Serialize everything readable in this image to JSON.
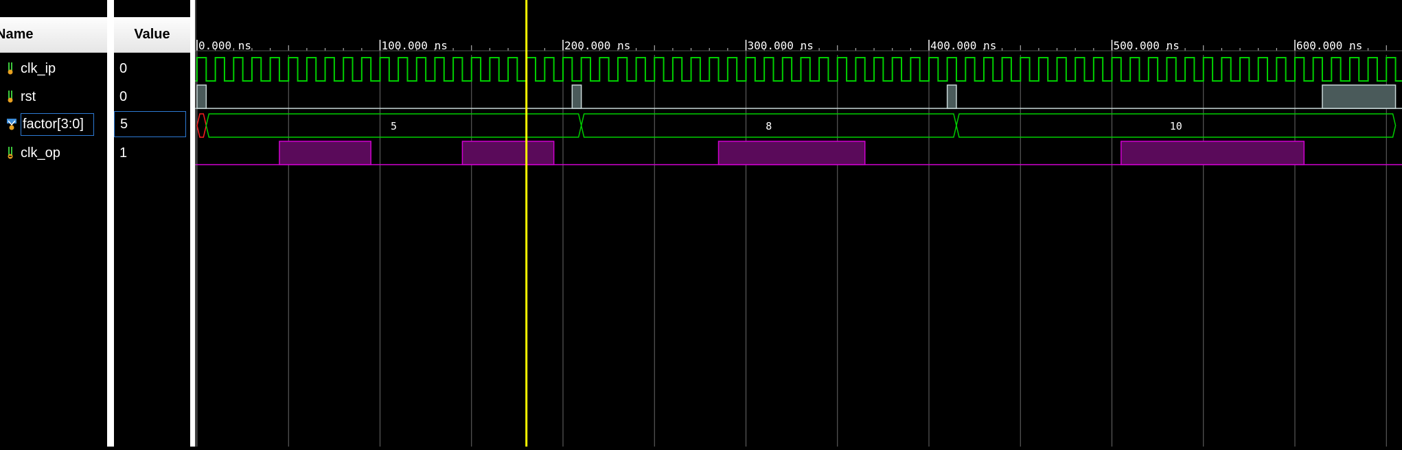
{
  "columns": {
    "name": "Name",
    "value": "Value"
  },
  "signals": [
    {
      "name": "clk_ip",
      "value": "0",
      "icon": "wire-icon",
      "color": "#00d000"
    },
    {
      "name": "rst",
      "value": "0",
      "icon": "wire-icon",
      "color": "#b8c8c8"
    },
    {
      "name": "factor[3:0]",
      "value": "5",
      "icon": "bus-icon",
      "color": "#00d000"
    },
    {
      "name": "clk_op",
      "value": "1",
      "icon": "output-wire-icon",
      "color": "#d000d0"
    }
  ],
  "time_axis": {
    "unit": "ns",
    "ticks": [
      "0.000 ns",
      "100.000 ns",
      "200.000 ns",
      "300.000 ns",
      "400.000 ns",
      "500.000 ns",
      "600.000 ns"
    ],
    "range_ns": [
      0,
      655
    ]
  },
  "cursor": {
    "time_ns": 180,
    "color": "#ffff00"
  },
  "waveforms": {
    "clk_ip": {
      "period_ns": 10,
      "start_ns": 0
    },
    "rst_high_ns": [
      [
        0,
        5
      ],
      [
        205,
        210
      ],
      [
        410,
        415
      ],
      [
        615,
        655
      ]
    ],
    "factor_values": [
      {
        "label": "",
        "from": 0,
        "to": 5
      },
      {
        "label": "5",
        "from": 5,
        "to": 210
      },
      {
        "label": "8",
        "from": 210,
        "to": 415
      },
      {
        "label": "10",
        "from": 415,
        "to": 655
      }
    ],
    "clk_op_high_ns": [
      [
        45,
        95
      ],
      [
        145,
        195
      ],
      [
        285,
        365
      ],
      [
        505,
        605
      ]
    ]
  }
}
